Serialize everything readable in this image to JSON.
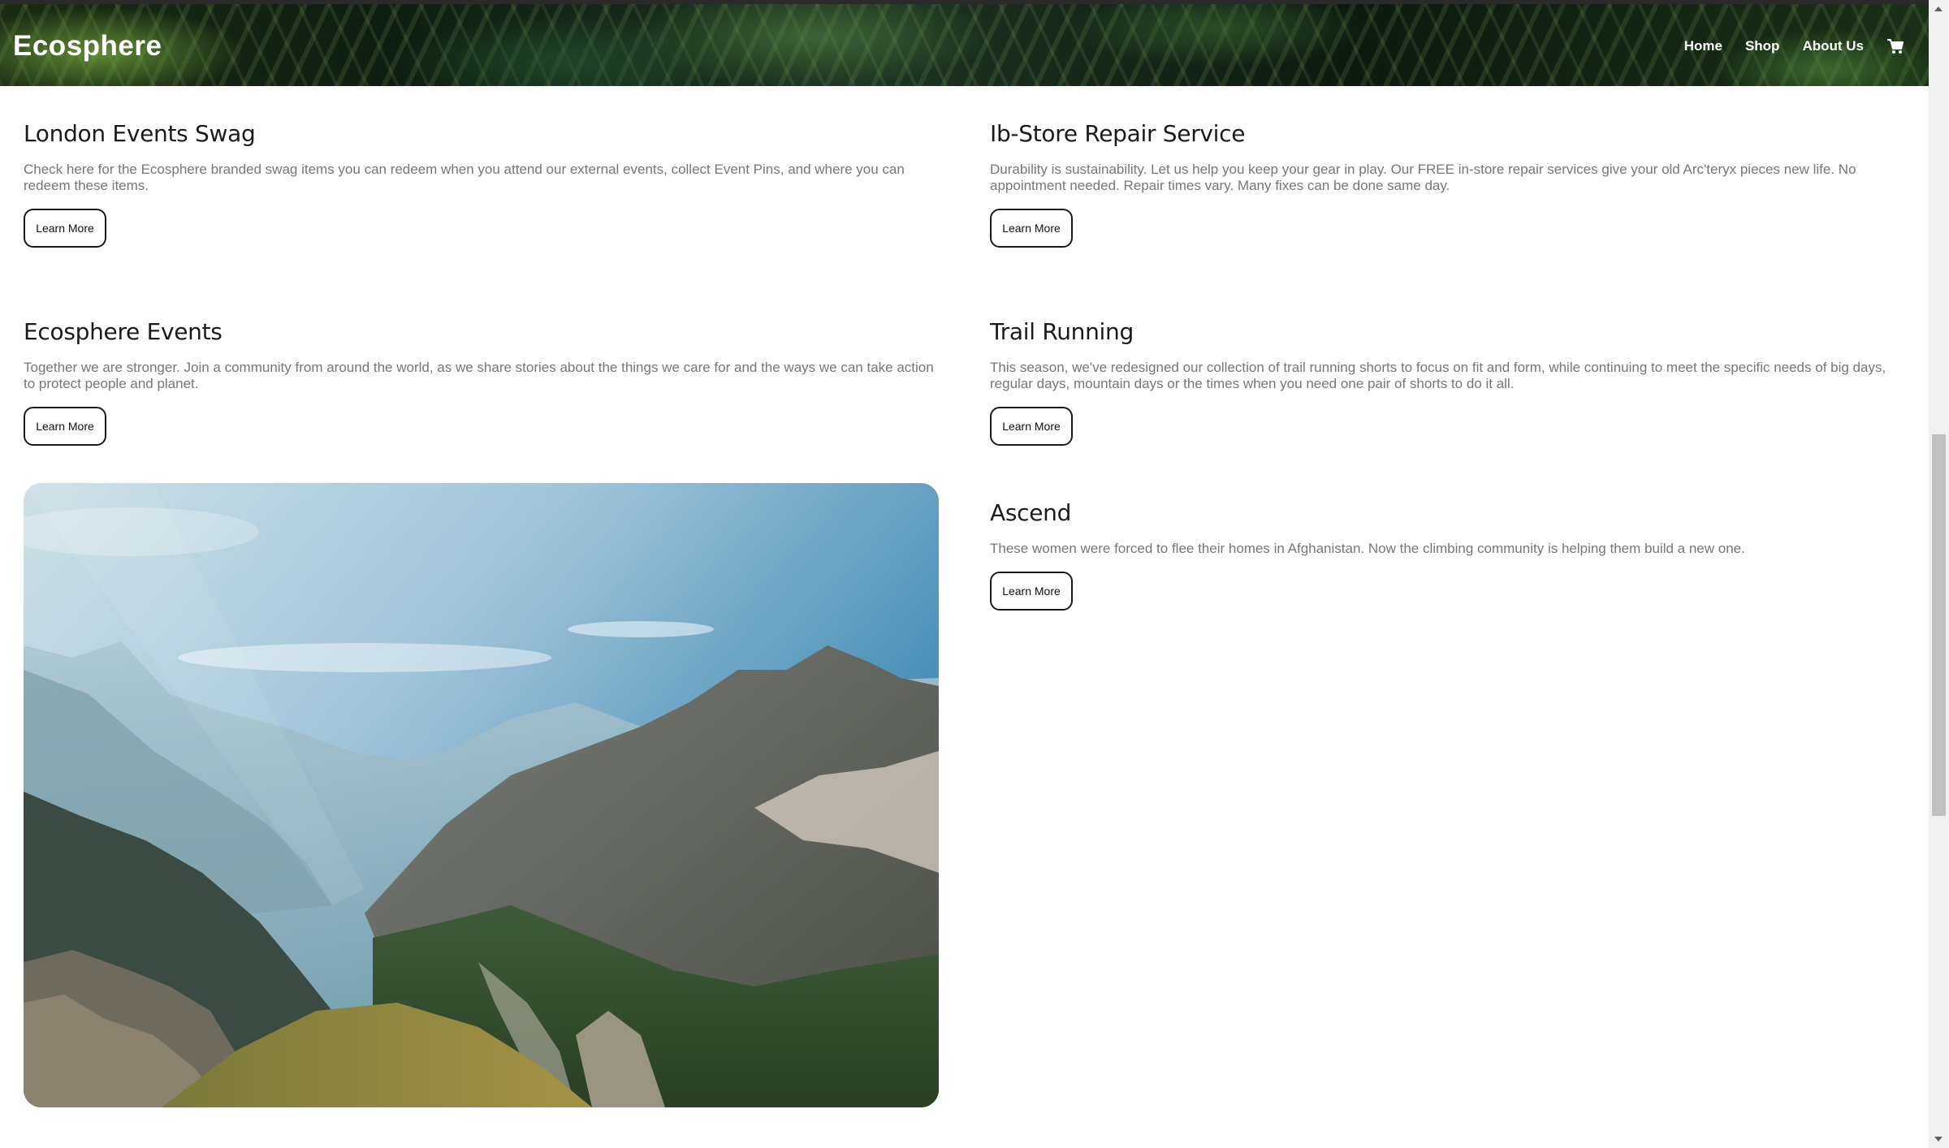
{
  "brand": "Ecosphere",
  "nav": {
    "home": "Home",
    "shop": "Shop",
    "about": "About Us",
    "cart_icon": "cart-icon"
  },
  "cards": [
    {
      "title": "London Events Swag",
      "text": "Check here for the Ecosphere branded swag items you can redeem when you attend our external events, collect Event Pins, and where you can redeem these items.",
      "button": "Learn More"
    },
    {
      "title": "Ib-Store Repair Service",
      "text": "Durability is sustainability. Let us help you keep your gear in play. Our FREE in-store repair services give your old Arc'teryx pieces new life. No appointment needed. Repair times vary. Many fixes can be done same day.",
      "button": "Learn More"
    },
    {
      "title": "Ecosphere Events",
      "text": "Together we are stronger. Join a community from around the world, as we share stories about the things we care for and the ways we can take action to protect people and planet.",
      "button": "Learn More"
    },
    {
      "title": "Trail Running",
      "text": "This season, we've redesigned our collection of trail running shorts to focus on fit and form, while continuing to meet the specific needs of big days, regular days, mountain days or the times when you need one pair of shorts to do it all.",
      "button": "Learn More"
    },
    {
      "title": "Ascend",
      "text": "These women were forced to flee their homes in Afghanistan. Now the climbing community is helping them build a new one.",
      "button": "Learn More"
    }
  ]
}
